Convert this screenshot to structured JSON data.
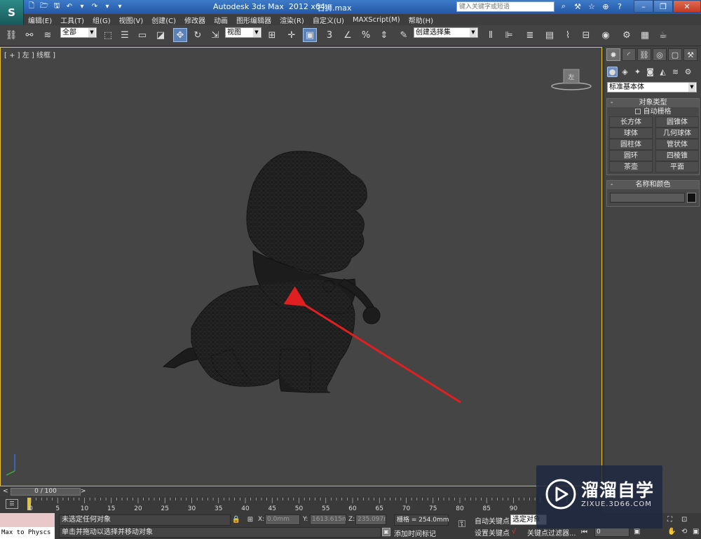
{
  "titlebar": {
    "logo_text": "S",
    "app_title": "Autodesk 3ds Max  2012 x64",
    "file_name": "石狮.max",
    "search_placeholder": "键入关键字或短语"
  },
  "menu": [
    "编辑(E)",
    "工具(T)",
    "组(G)",
    "视图(V)",
    "创建(C)",
    "修改器",
    "动画",
    "图形编辑器",
    "渲染(R)",
    "自定义(U)",
    "MAXScript(M)",
    "帮助(H)"
  ],
  "toolbar": {
    "selection_filter": "全部",
    "ref_coord": "视图",
    "named_selection": "创建选择集"
  },
  "viewport": {
    "label": "[ + ] 左 ] 线框 ]",
    "viewcube_face": "左"
  },
  "command_panel": {
    "category": "标准基本体",
    "object_type_title": "对象类型",
    "autogrid_label": "自动栅格",
    "objects": [
      "长方体",
      "圆锥体",
      "球体",
      "几何球体",
      "圆柱体",
      "管状体",
      "圆环",
      "四棱锥",
      "茶壶",
      "平面"
    ],
    "name_color_title": "名称和颜色"
  },
  "timeline": {
    "frame_display": "0 / 100",
    "ticks": [
      "0",
      "5",
      "10",
      "15",
      "20",
      "25",
      "30",
      "35",
      "40",
      "45",
      "50",
      "55",
      "60",
      "65",
      "70",
      "75",
      "80",
      "85",
      "90"
    ]
  },
  "status": {
    "listener_text": "Max to Physcs (",
    "selection": "未选定任何对象",
    "prompt": "单击并拖动以选择并移动对象",
    "x_label": "X:",
    "x_value": "0.0mm",
    "y_label": "Y:",
    "y_value": "1613.615m",
    "z_label": "Z:",
    "z_value": "235.097mm",
    "grid": "栅格 = 254.0mm",
    "add_time_tag": "添加时间标记",
    "auto_key": "自动关键点",
    "set_key": "设置关键点",
    "selected_dropdown": "选定对象",
    "key_filters": "关键点过滤器...",
    "frame_value": "0"
  },
  "watermark": {
    "title": "溜溜自学",
    "url": "ZIXUE.3D66.COM"
  }
}
